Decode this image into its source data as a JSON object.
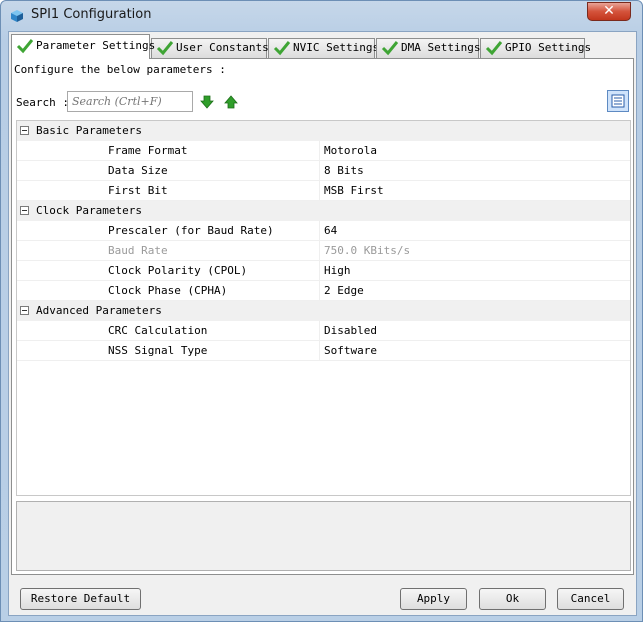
{
  "window": {
    "title": "SPI1 Configuration",
    "close_label": "✕"
  },
  "tabs": [
    {
      "label": "Parameter Settings",
      "active": true
    },
    {
      "label": "User Constants",
      "active": false
    },
    {
      "label": "NVIC Settings",
      "active": false
    },
    {
      "label": "DMA Settings",
      "active": false
    },
    {
      "label": "GPIO Settings",
      "active": false
    }
  ],
  "panel": {
    "instruction": "Configure the below parameters :",
    "search_label": "Search :",
    "search_placeholder": "Search (Crtl+F)"
  },
  "groups": [
    {
      "label": "Basic Parameters",
      "params": [
        {
          "name": "Frame Format",
          "value": "Motorola",
          "disabled": false
        },
        {
          "name": "Data Size",
          "value": "8 Bits",
          "disabled": false
        },
        {
          "name": "First Bit",
          "value": "MSB First",
          "disabled": false
        }
      ]
    },
    {
      "label": "Clock Parameters",
      "params": [
        {
          "name": "Prescaler (for Baud Rate)",
          "value": "64",
          "disabled": false
        },
        {
          "name": "Baud Rate",
          "value": "750.0 KBits/s",
          "disabled": true
        },
        {
          "name": "Clock Polarity (CPOL)",
          "value": "High",
          "disabled": false
        },
        {
          "name": "Clock Phase (CPHA)",
          "value": "2 Edge",
          "disabled": false
        }
      ]
    },
    {
      "label": "Advanced Parameters",
      "params": [
        {
          "name": "CRC Calculation",
          "value": "Disabled",
          "disabled": false
        },
        {
          "name": "NSS Signal Type",
          "value": "Software",
          "disabled": false
        }
      ]
    }
  ],
  "buttons": {
    "restore": "Restore Default",
    "apply": "Apply",
    "ok": "Ok",
    "cancel": "Cancel"
  },
  "colors": {
    "check_green": "#3fa535",
    "arrow_green": "#2f9e2a",
    "close_red": "#c2361d"
  }
}
